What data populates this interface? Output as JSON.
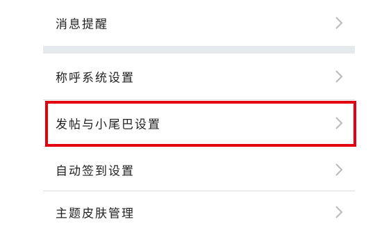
{
  "settings": {
    "items": [
      {
        "label": "消息提醒"
      },
      {
        "label": "称呼系统设置"
      },
      {
        "label": "发帖与小尾巴设置"
      },
      {
        "label": "自动签到设置"
      },
      {
        "label": "主题皮肤管理"
      }
    ],
    "chevron_icon": "chevron-right-icon"
  },
  "annotation": {
    "highlight_color": "#e3000f",
    "highlighted_item": "发帖与小尾巴设置"
  }
}
